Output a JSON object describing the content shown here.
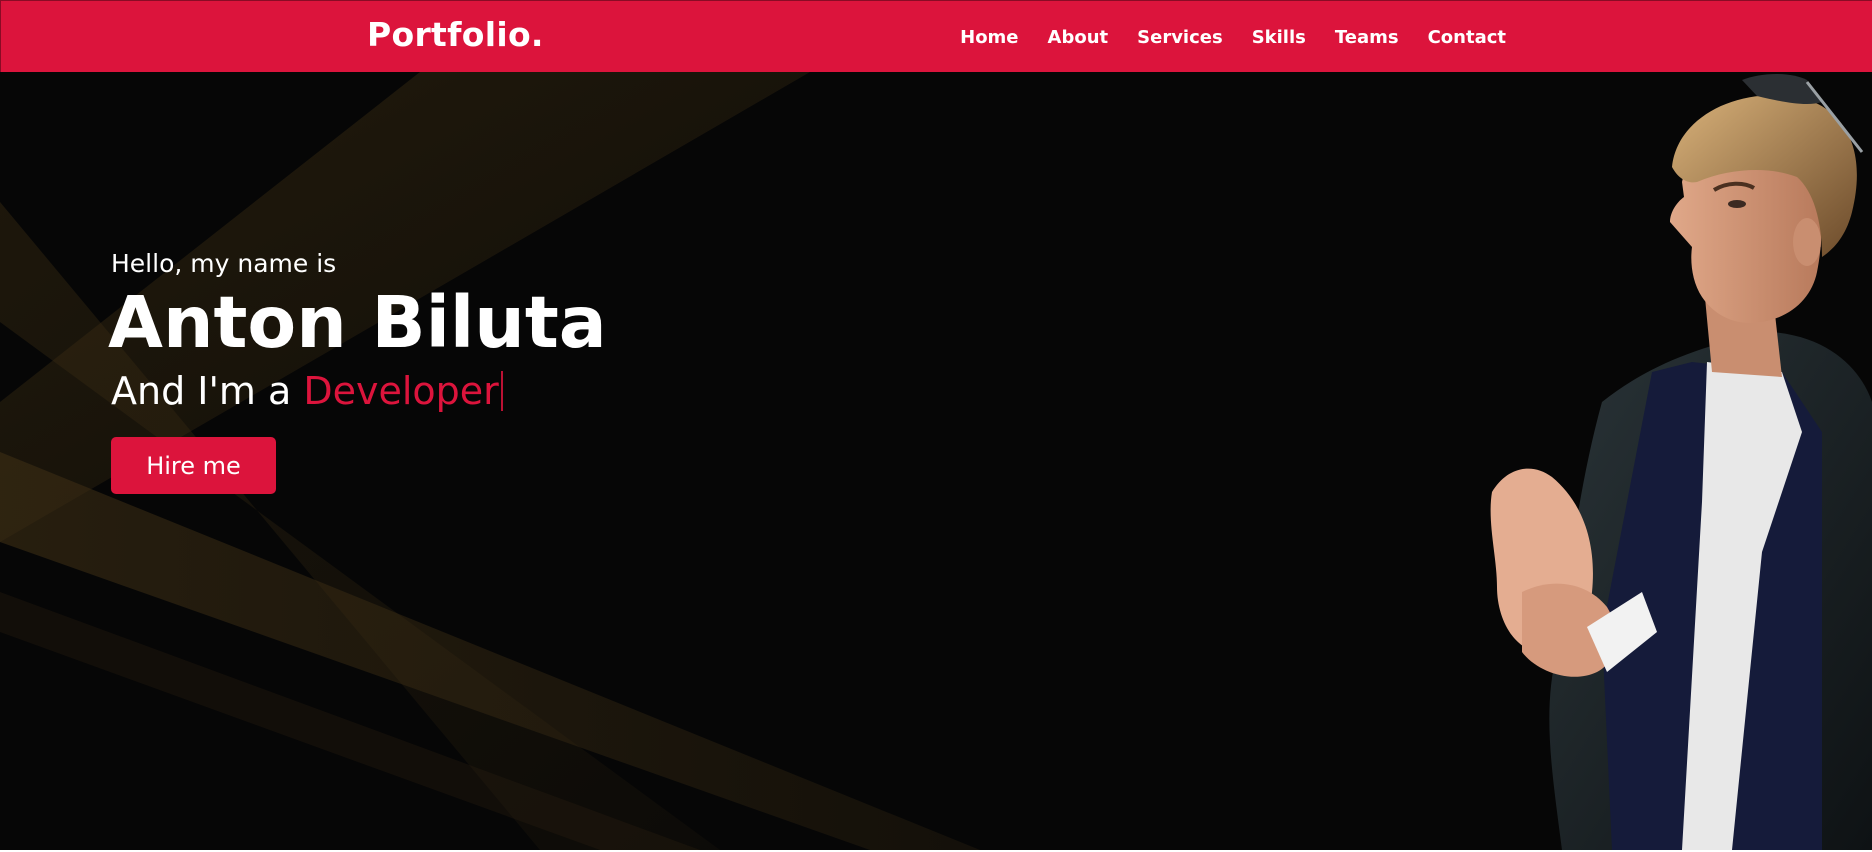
{
  "navbar": {
    "logo": "Portfolio.",
    "links": [
      {
        "label": "Home"
      },
      {
        "label": "About"
      },
      {
        "label": "Services"
      },
      {
        "label": "Skills"
      },
      {
        "label": "Teams"
      },
      {
        "label": "Contact"
      }
    ]
  },
  "hero": {
    "greeting": "Hello, my name is",
    "name": "Anton Biluta",
    "role_prefix": "And I'm a",
    "role_word": "Developer",
    "hire_button": "Hire me"
  },
  "colors": {
    "brand": "#dc143c",
    "hero_background": "#060606",
    "light_beams": "#2a2010"
  },
  "icons": {
    "portrait": "person-photo"
  }
}
